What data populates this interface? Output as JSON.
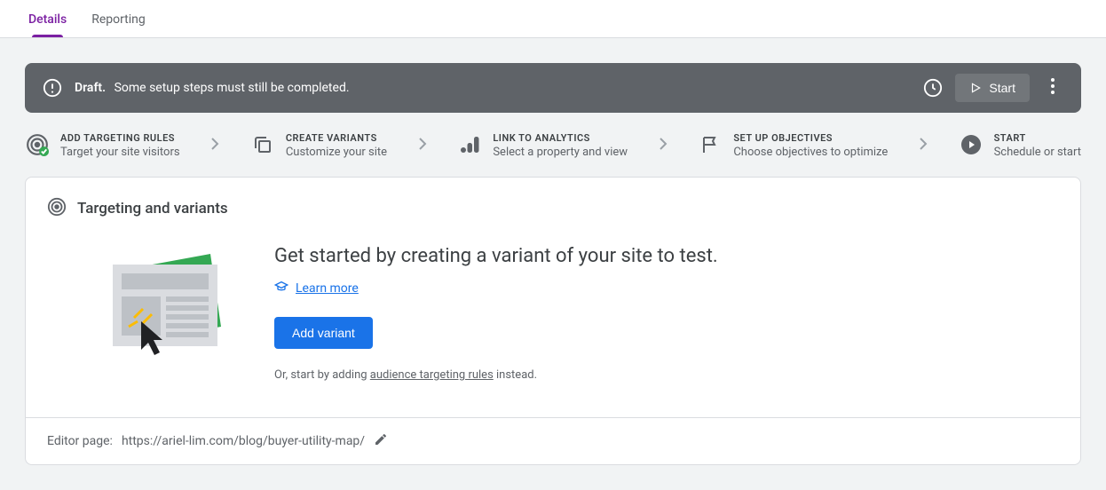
{
  "tabs": {
    "details": "Details",
    "reporting": "Reporting"
  },
  "statusBar": {
    "draftLabel": "Draft.",
    "message": "Some setup steps must still be completed.",
    "startLabel": "Start"
  },
  "steps": [
    {
      "title": "ADD TARGETING RULES",
      "sub": "Target your site visitors"
    },
    {
      "title": "CREATE VARIANTS",
      "sub": "Customize your site"
    },
    {
      "title": "LINK TO ANALYTICS",
      "sub": "Select a property and view"
    },
    {
      "title": "SET UP OBJECTIVES",
      "sub": "Choose objectives to optimize"
    },
    {
      "title": "START",
      "sub": "Schedule or start"
    }
  ],
  "card": {
    "header": "Targeting and variants",
    "ctaTitle": "Get started by creating a variant of your site to test.",
    "learnMore": "Learn more",
    "addVariant": "Add variant",
    "altPrefix": "Or, start by adding ",
    "altLink": "audience targeting rules",
    "altSuffix": " instead.",
    "footerLabel": "Editor page: ",
    "footerUrl": "https://ariel-lim.com/blog/buyer-utility-map/"
  }
}
